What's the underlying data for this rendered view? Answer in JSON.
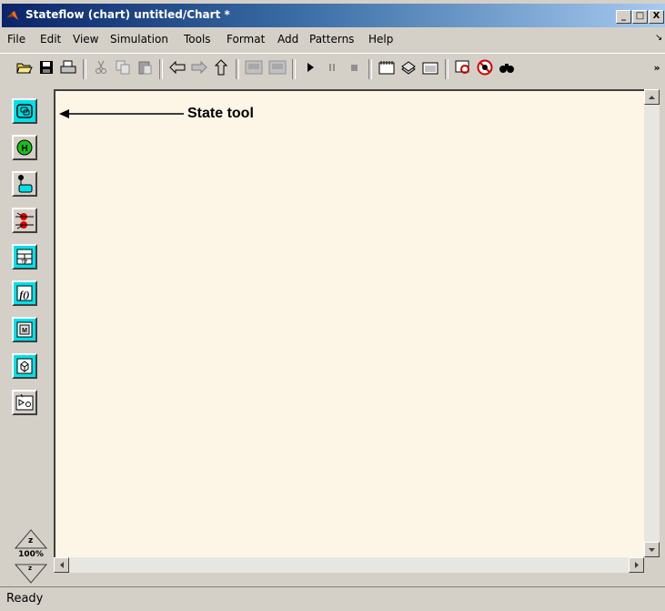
{
  "window": {
    "title": "Stateflow (chart) untitled/Chart *",
    "minimize_glyph": "_",
    "maximize_glyph": "□",
    "close_glyph": "X"
  },
  "menu": {
    "items": [
      "File",
      "Edit",
      "View",
      "Simulation",
      "Tools",
      "Format",
      "Add",
      "Patterns",
      "Help"
    ]
  },
  "toolbar": {
    "icons": [
      "open-folder-icon",
      "save-icon",
      "print-icon",
      "cut-icon",
      "copy-icon",
      "paste-icon",
      "back-arrow-icon",
      "forward-arrow-icon",
      "up-arrow-icon",
      "undo-icon",
      "redo-icon",
      "start-icon",
      "pause-icon",
      "stop-icon",
      "build-icon",
      "library-icon",
      "target-icon",
      "explorer-icon",
      "debug-icon",
      "find-icon"
    ],
    "overflow_glyph": "»"
  },
  "palette": {
    "tools": [
      "state-tool-icon",
      "history-junction-icon",
      "default-transition-icon",
      "connective-junction-icon",
      "truth-table-icon",
      "graphical-function-icon",
      "embedded-matlab-icon",
      "box-icon",
      "simulink-function-icon"
    ],
    "zoom_label": "100%",
    "zoom_in_glyph": "z",
    "zoom_out_glyph": "z"
  },
  "canvas": {
    "annotation": "State tool"
  },
  "status": {
    "text": "Ready"
  },
  "colors": {
    "title_start": "#0a246a",
    "title_end": "#a6caf0",
    "canvas_bg": "#fdf5e6",
    "palette_button": "#00e0e8",
    "chrome": "#d4d0c8"
  }
}
